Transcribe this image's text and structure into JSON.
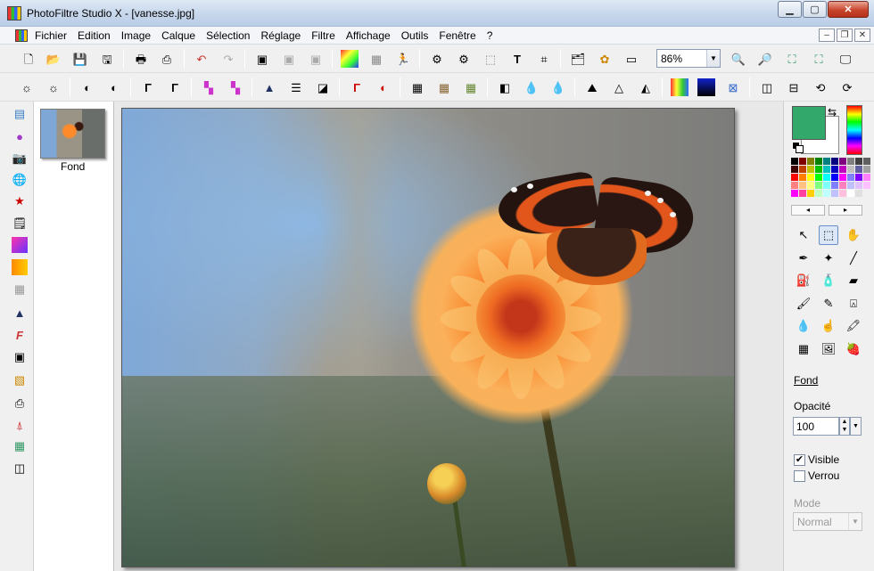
{
  "window": {
    "title": "PhotoFiltre Studio X - [vanesse.jpg]"
  },
  "menu": {
    "items": [
      "Fichier",
      "Edition",
      "Image",
      "Calque",
      "Sélection",
      "Réglage",
      "Filtre",
      "Affichage",
      "Outils",
      "Fenêtre",
      "?"
    ]
  },
  "toolbar": {
    "zoom_value": "86%"
  },
  "layers": {
    "items": [
      {
        "label": "Fond"
      }
    ]
  },
  "properties": {
    "layer_name": "Fond",
    "opacity_label": "Opacité",
    "opacity_value": "100",
    "visible_label": "Visible",
    "visible_checked": true,
    "lock_label": "Verrou",
    "lock_checked": false,
    "mode_label": "Mode",
    "mode_value": "Normal"
  },
  "colors": {
    "foreground": "#33a86b",
    "background": "#ffffff"
  }
}
